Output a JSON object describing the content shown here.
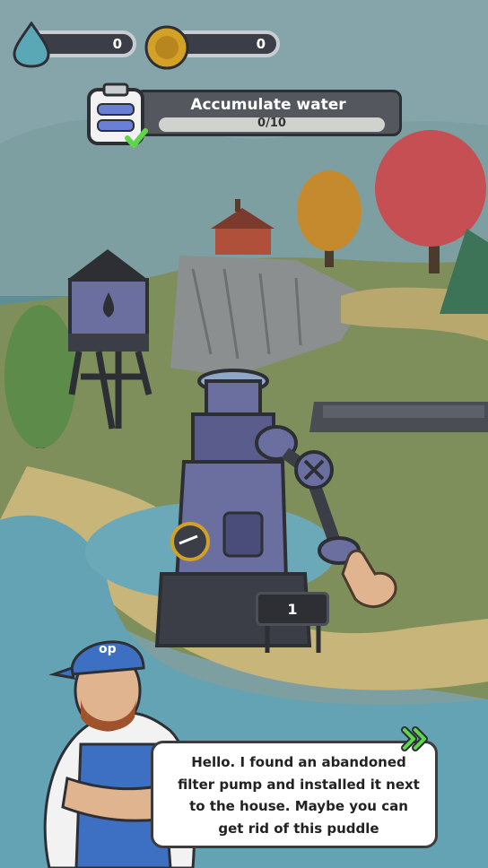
{
  "hud": {
    "water": {
      "icon": "water-drop-icon",
      "value": "0"
    },
    "coins": {
      "icon": "coin-icon",
      "value": "0"
    }
  },
  "task": {
    "icon": "clipboard-check-icon",
    "title": "Accumulate water",
    "progress_text": "0/10",
    "progress_fraction": 0
  },
  "pump": {
    "counter": "1"
  },
  "dialog": {
    "speaker": "plumber-character",
    "text": "Hello. I found an abandoned filter pump and installed it next to the house. Maybe you can get rid of this puddle",
    "next_icon": "double-chevron-right-icon"
  },
  "colors": {
    "accent_green": "#5fd64a",
    "water": "#5aa8b6",
    "coin": "#d4a127",
    "hud_dark": "#3b3e46"
  }
}
